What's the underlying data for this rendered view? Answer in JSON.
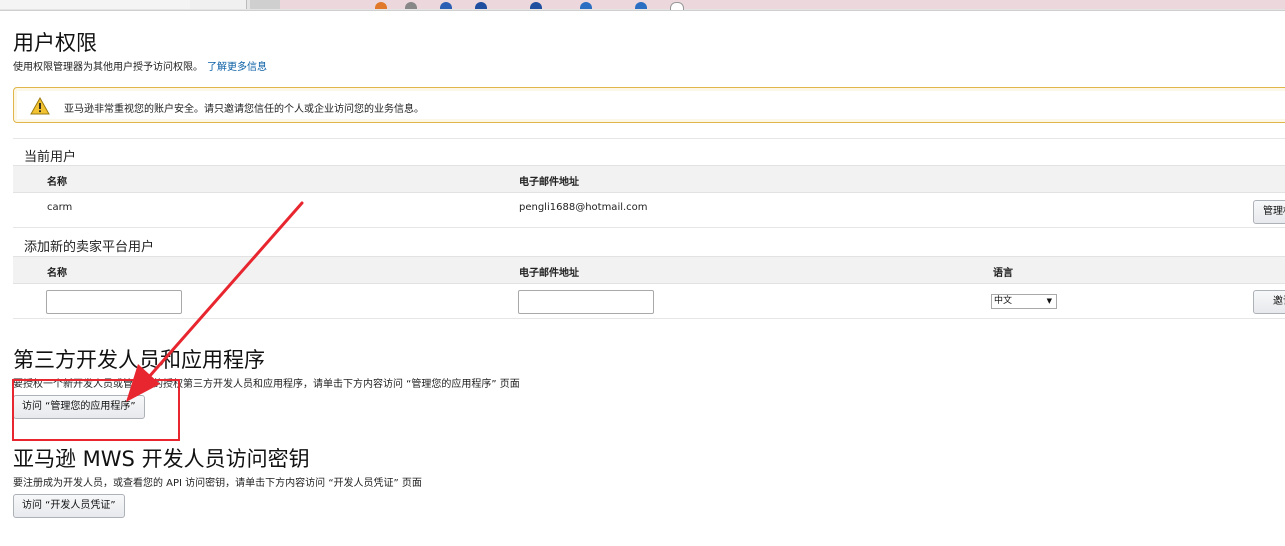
{
  "page": {
    "title": "用户权限",
    "subtitle": "使用权限管理器为其他用户授予访问权限。",
    "learn_more": "了解更多信息"
  },
  "alert": {
    "icon": "warning-icon",
    "message": "亚马逊非常重视您的账户安全。请只邀请您信任的个人或企业访问您的业务信息。"
  },
  "current_users": {
    "section_title": "当前用户",
    "columns": [
      "名称",
      "电子邮件地址"
    ],
    "rows": [
      {
        "name": "carm",
        "email": "pengli1688@hotmail.com",
        "action_label": "管理权限"
      }
    ]
  },
  "add_user": {
    "section_title": "添加新的卖家平台用户",
    "columns": [
      "名称",
      "电子邮件地址",
      "语言"
    ],
    "name_value": "",
    "email_value": "",
    "language_selected": "中文",
    "invite_label": "邀请"
  },
  "third_party": {
    "title": "第三方开发人员和应用程序",
    "description": "要授权一个新开发人员或管理您的授权第三方开发人员和应用程序，请单击下方内容访问 “管理您的应用程序” 页面",
    "button_label": "访问 “管理您的应用程序”"
  },
  "mws": {
    "title": "亚马逊 MWS 开发人员访问密钥",
    "description": "要注册成为开发人员，或查看您的 API 访问密钥，请单击下方内容访问 “开发人员凭证” 页面",
    "button_label": "访问 “开发人员凭证”"
  },
  "annotation": {
    "color": "#e8262f"
  }
}
